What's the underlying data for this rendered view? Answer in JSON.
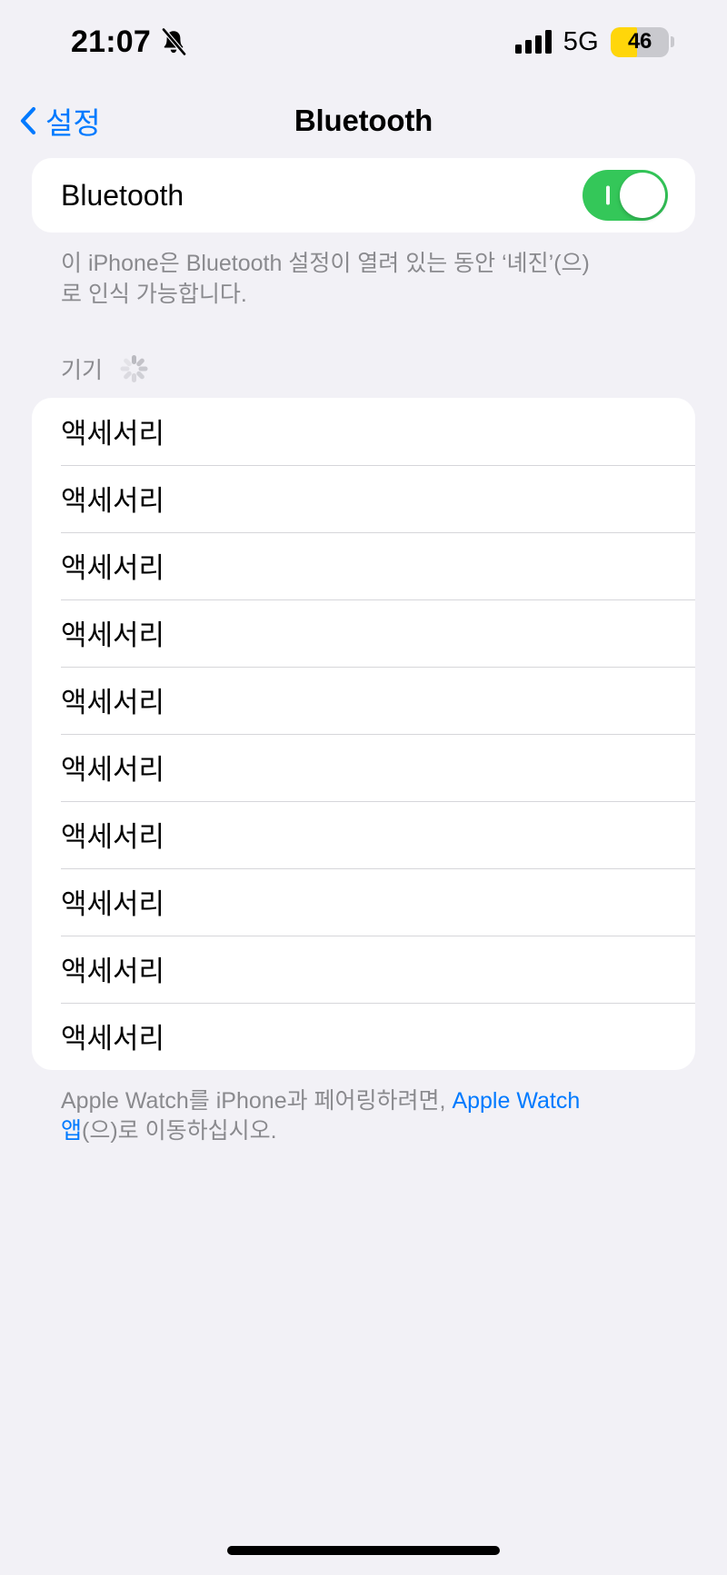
{
  "status_bar": {
    "time": "21:07",
    "mute_icon": "bell-slash-icon",
    "signal_icon": "cellular-signal-icon",
    "network": "5G",
    "battery_percent": "46",
    "battery_level": 46,
    "battery_color": "#ffd60a",
    "battery_track_color": "#c9c9ce"
  },
  "nav": {
    "back_label": "설정",
    "back_icon": "chevron-left-icon",
    "title": "Bluetooth",
    "accent_color": "#007aff"
  },
  "bluetooth": {
    "label": "Bluetooth",
    "toggle_on": true,
    "toggle_on_color": "#34c759",
    "description": "이 iPhone은 Bluetooth 설정이 열려 있는 동안 ‘녜진’(으)로 인식 가능합니다."
  },
  "devices_section": {
    "header": "기기",
    "spinner_icon": "activity-spinner-icon",
    "items": [
      {
        "name": "액세서리"
      },
      {
        "name": "액세서리"
      },
      {
        "name": "액세서리"
      },
      {
        "name": "액세서리"
      },
      {
        "name": "액세서리"
      },
      {
        "name": "액세서리"
      },
      {
        "name": "액세서리"
      },
      {
        "name": "액세서리"
      },
      {
        "name": "액세서리"
      },
      {
        "name": "액세서리"
      }
    ]
  },
  "footer": {
    "text_before": "Apple Watch를 iPhone과 페어링하려면, ",
    "link_text": "Apple Watch 앱",
    "text_after": "(으)로 이동하십시오."
  }
}
